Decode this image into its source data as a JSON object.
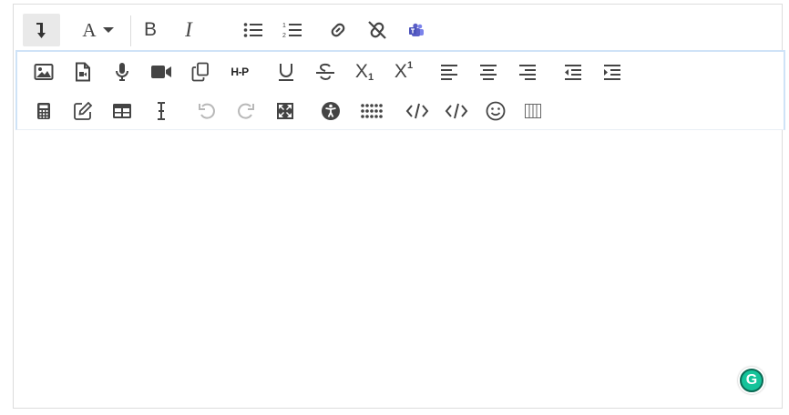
{
  "toolbar": {
    "row1": {
      "toggle_label": "Show more buttons",
      "font_color_label": "A",
      "bold_label": "B",
      "italic_label": "I"
    },
    "row2": {
      "h5p_label": "H-P",
      "subscript_base": "X",
      "subscript_index": "1",
      "superscript_base": "X",
      "superscript_index": "1"
    }
  },
  "grammarly": {
    "label": "G"
  },
  "colors": {
    "border": "#dcdcdc",
    "panel_border": "#cfe3f7",
    "icon": "#444444",
    "disabled_icon": "#b8b8b8",
    "teams_icon": "#5b5fc7",
    "grammarly": "#15c39a"
  }
}
